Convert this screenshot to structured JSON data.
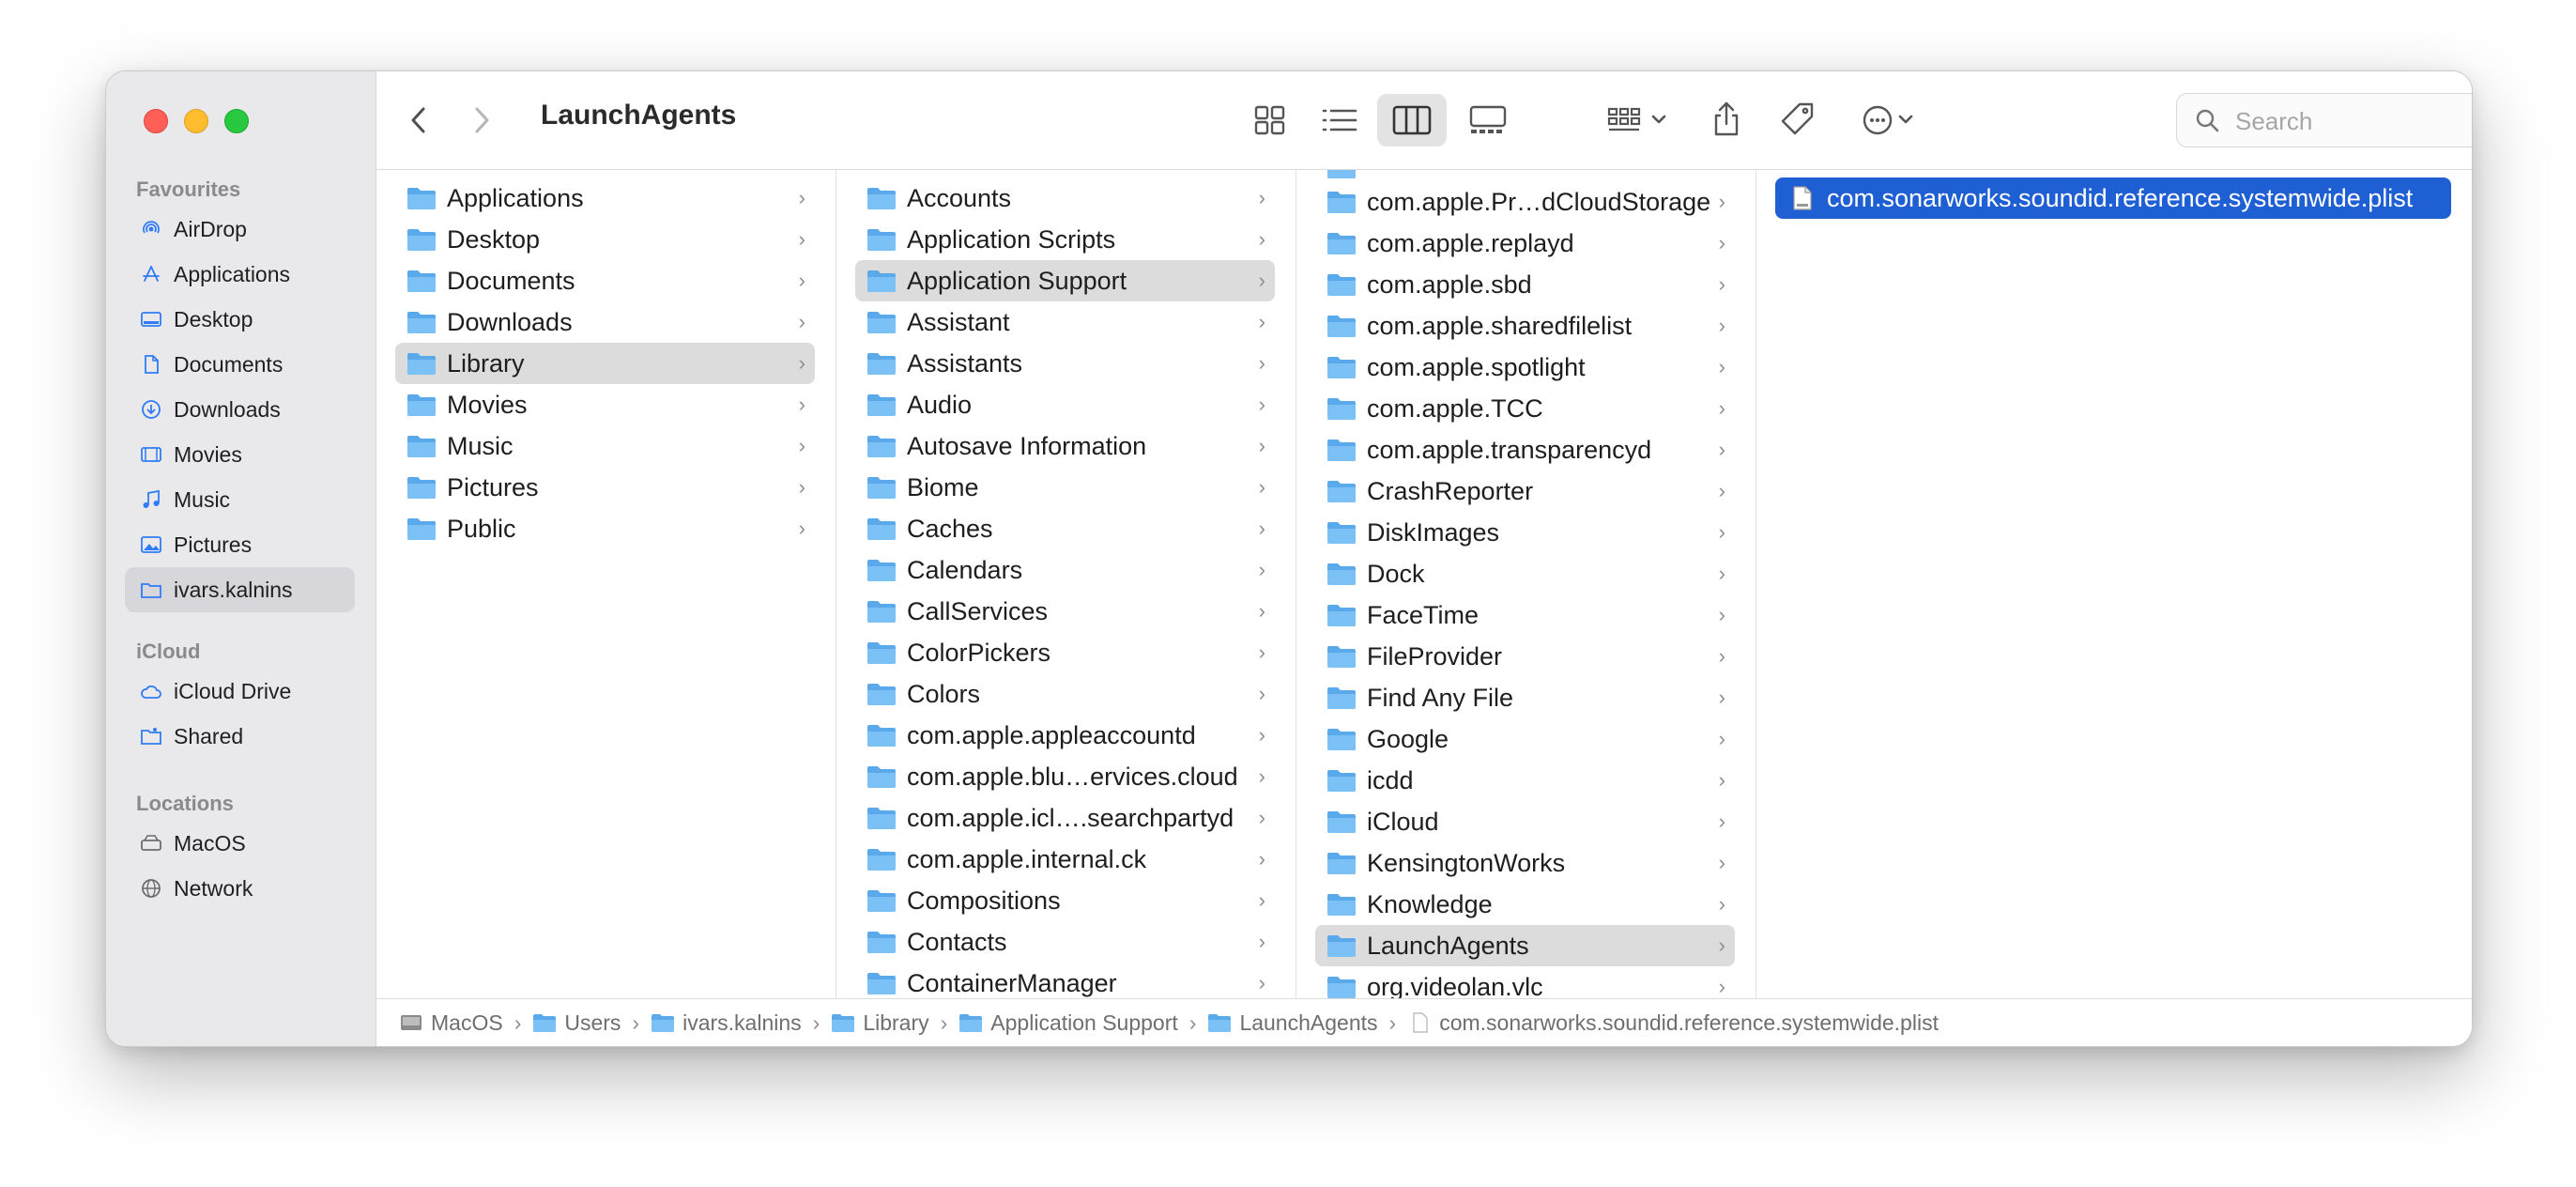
{
  "window": {
    "title": "LaunchAgents",
    "traffic_lights": [
      "close",
      "minimize",
      "zoom"
    ]
  },
  "sidebar": {
    "favourites_title": "Favourites",
    "favourites": [
      {
        "label": "AirDrop",
        "icon": "airdrop-icon"
      },
      {
        "label": "Applications",
        "icon": "applications-icon"
      },
      {
        "label": "Desktop",
        "icon": "desktop-icon"
      },
      {
        "label": "Documents",
        "icon": "document-icon"
      },
      {
        "label": "Downloads",
        "icon": "downloads-icon"
      },
      {
        "label": "Movies",
        "icon": "movies-icon"
      },
      {
        "label": "Music",
        "icon": "music-icon"
      },
      {
        "label": "Pictures",
        "icon": "pictures-icon"
      },
      {
        "label": "ivars.kalnins",
        "icon": "home-folder-icon"
      }
    ],
    "icloud_title": "iCloud",
    "icloud": [
      {
        "label": "iCloud Drive",
        "icon": "cloud-icon"
      },
      {
        "label": "Shared",
        "icon": "shared-folder-icon"
      }
    ],
    "locations_title": "Locations",
    "locations": [
      {
        "label": "MacOS",
        "icon": "disk-icon"
      },
      {
        "label": "Network",
        "icon": "globe-icon"
      }
    ]
  },
  "toolbar": {
    "search_placeholder": "Search"
  },
  "columns": {
    "col1": [
      "Applications",
      "Desktop",
      "Documents",
      "Downloads",
      "Library",
      "Movies",
      "Music",
      "Pictures",
      "Public"
    ],
    "col2": [
      "Accounts",
      "Application Scripts",
      "Application Support",
      "Assistant",
      "Assistants",
      "Audio",
      "Autosave Information",
      "Biome",
      "Caches",
      "Calendars",
      "CallServices",
      "ColorPickers",
      "Colors",
      "com.apple.appleaccountd",
      "com.apple.blu…ervices.cloud",
      "com.apple.icl….searchpartyd",
      "com.apple.internal.ck",
      "Compositions",
      "Contacts",
      "ContainerManager"
    ],
    "col3": [
      "com.apple.Pr…dCloudStorage",
      "com.apple.replayd",
      "com.apple.sbd",
      "com.apple.sharedfilelist",
      "com.apple.spotlight",
      "com.apple.TCC",
      "com.apple.transparencyd",
      "CrashReporter",
      "DiskImages",
      "Dock",
      "FaceTime",
      "FileProvider",
      "Find Any File",
      "Google",
      "icdd",
      "iCloud",
      "KensingtonWorks",
      "Knowledge",
      "LaunchAgents",
      "org.videolan.vlc"
    ],
    "col4": [
      "com.sonarworks.soundid.reference.systemwide.plist"
    ]
  },
  "pathbar": [
    "MacOS",
    "Users",
    "ivars.kalnins",
    "Library",
    "Application Support",
    "LaunchAgents",
    "com.sonarworks.soundid.reference.systemwide.plist"
  ],
  "colors": {
    "selection_blue": "#1f5fd4",
    "folder_blue": "#6cb4ee",
    "sidebar_bg": "#e9e8eb"
  }
}
